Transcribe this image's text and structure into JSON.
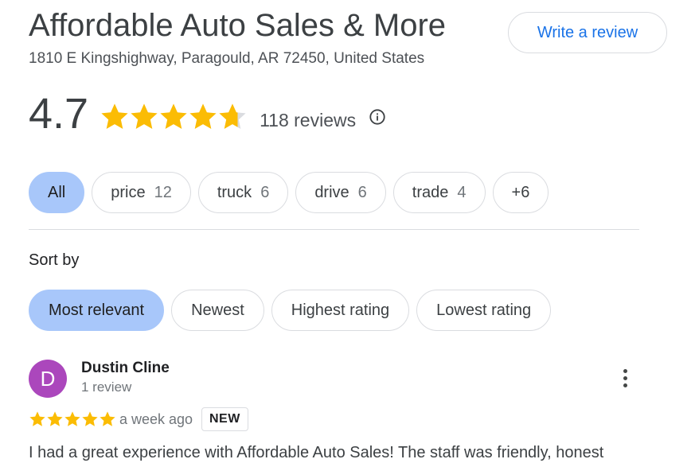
{
  "place": {
    "name": "Affordable Auto Sales & More",
    "address": "1810 E Kingshighway, Paragould, AR 72450, United States",
    "write_review_label": "Write a review"
  },
  "rating": {
    "value": "4.7",
    "stars_out_of_5": 4.7,
    "reviews_label": "118 reviews",
    "info_icon": "info-circle-icon",
    "star_color": "#fbbc04",
    "star_empty_color": "#dadce0"
  },
  "topic_chips": [
    {
      "label": "All",
      "count": "",
      "selected": true
    },
    {
      "label": "price",
      "count": "12",
      "selected": false
    },
    {
      "label": "truck",
      "count": "6",
      "selected": false
    },
    {
      "label": "drive",
      "count": "6",
      "selected": false
    },
    {
      "label": "trade",
      "count": "4",
      "selected": false
    },
    {
      "label": "+6",
      "count": "",
      "selected": false
    }
  ],
  "sort": {
    "label": "Sort by",
    "options": [
      {
        "label": "Most relevant",
        "selected": true
      },
      {
        "label": "Newest",
        "selected": false
      },
      {
        "label": "Highest rating",
        "selected": false
      },
      {
        "label": "Lowest rating",
        "selected": false
      }
    ]
  },
  "review": {
    "avatar_letter": "D",
    "avatar_color": "#ab47bc",
    "author": "Dustin Cline",
    "author_meta": "1 review",
    "stars": 5,
    "time": "a week ago",
    "badge": "NEW",
    "more_icon": "more-vert-icon",
    "text": "I had a great experience with Affordable Auto Sales! The staff was friendly, honest"
  },
  "colors": {
    "accent": "#1a73e8",
    "selected_chip": "#a8c7fa"
  }
}
